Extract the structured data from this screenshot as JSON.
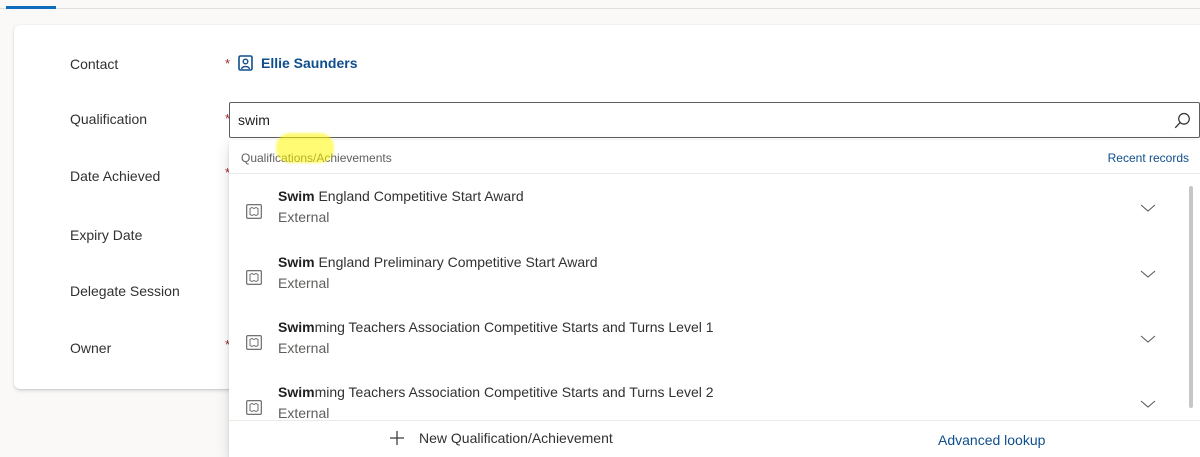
{
  "form": {
    "contact": {
      "label": "Contact",
      "required_mark": "*",
      "value": "Ellie Saunders"
    },
    "qualification": {
      "label": "Qualification",
      "required_mark": "*",
      "search_value": "swim"
    },
    "date_achieved": {
      "label": "Date Achieved",
      "required_mark": "*"
    },
    "expiry_date": {
      "label": "Expiry Date"
    },
    "delegate_session": {
      "label": "Delegate Session"
    },
    "owner": {
      "label": "Owner",
      "required_mark": "*"
    }
  },
  "lookup": {
    "category": "Qualifications/Achievements",
    "recent_label": "Recent records",
    "results": [
      {
        "match": "Swim",
        "rest": " England Competitive Start Award",
        "subtitle": "External"
      },
      {
        "match": "Swim",
        "rest": " England Preliminary Competitive Start Award",
        "subtitle": "External"
      },
      {
        "match": "Swim",
        "rest": "ming Teachers Association Competitive Starts and Turns Level 1",
        "subtitle": "External"
      },
      {
        "match": "Swim",
        "rest": "ming Teachers Association Competitive Starts and Turns Level 2",
        "subtitle": "External"
      }
    ],
    "new_label": "New Qualification/Achievement",
    "advanced_label": "Advanced lookup"
  },
  "icons": {
    "contact": "contact-card-icon",
    "search": "search-icon",
    "result": "entity-record-icon",
    "expand": "chevron-down-icon",
    "add": "plus-icon"
  },
  "colors": {
    "accent": "#0f6cbd",
    "link": "#0f4e8c",
    "required": "#a4262c",
    "highlight": "#fff700"
  }
}
